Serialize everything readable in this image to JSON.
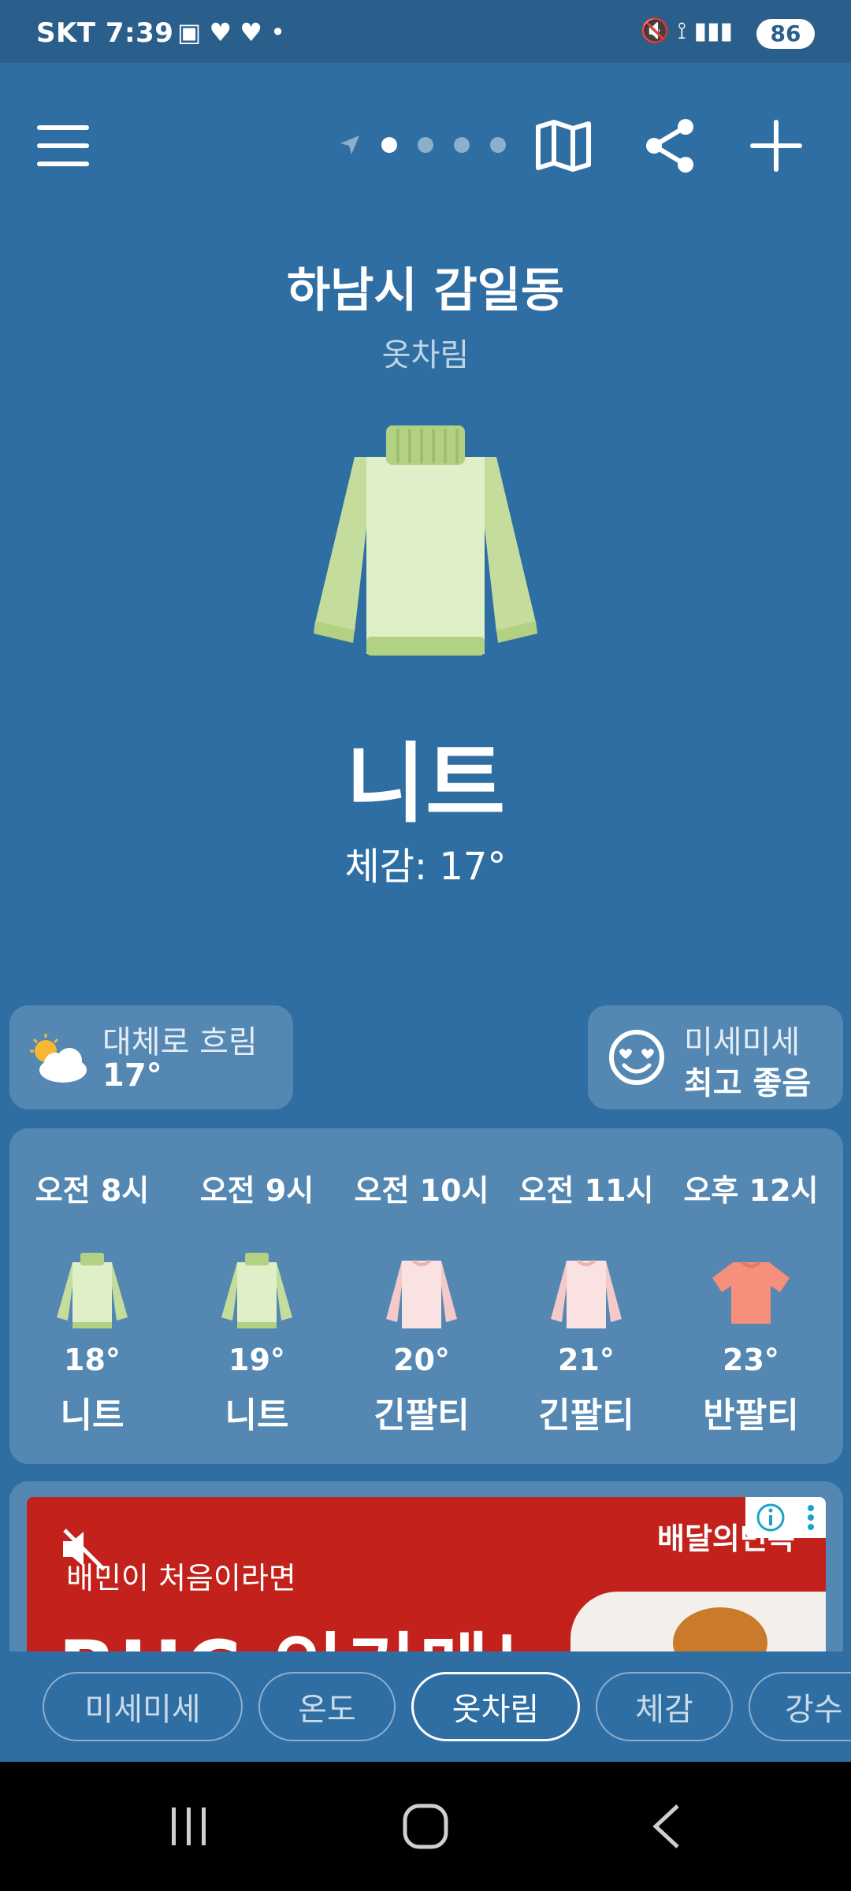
{
  "status_bar": {
    "carrier": "SKT",
    "time": "7:39",
    "battery": "86"
  },
  "header": {
    "location": "하남시 감일동",
    "subtitle": "옷차림"
  },
  "main": {
    "clothing": "니트",
    "feels_like": "체감: 17°"
  },
  "weather_card": {
    "condition": "대체로 흐림",
    "temp": "17°"
  },
  "dust_card": {
    "title": "미세미세",
    "status": "최고 좋음"
  },
  "hourly": [
    {
      "time": "오전 8시",
      "temp": "18°",
      "clothing": "니트",
      "icon": "sweater-icon"
    },
    {
      "time": "오전 9시",
      "temp": "19°",
      "clothing": "니트",
      "icon": "sweater-icon"
    },
    {
      "time": "오전 10시",
      "temp": "20°",
      "clothing": "긴팔티",
      "icon": "long-sleeve-icon"
    },
    {
      "time": "오전 11시",
      "temp": "21°",
      "clothing": "긴팔티",
      "icon": "long-sleeve-icon"
    },
    {
      "time": "오후 12시",
      "temp": "23°",
      "clothing": "반팔티",
      "icon": "tshirt-icon"
    }
  ],
  "ad": {
    "brand": "배달의민족",
    "subtext": "배민이 처음이라면",
    "headline": "BHC 인기메뉴"
  },
  "tabs": [
    {
      "label": "미세미세",
      "active": false
    },
    {
      "label": "온도",
      "active": false
    },
    {
      "label": "옷차림",
      "active": true
    },
    {
      "label": "체감",
      "active": false
    },
    {
      "label": "강수",
      "active": false
    }
  ],
  "colors": {
    "background": "#2f6ea3",
    "sweater": "#c4dd9c",
    "long_sleeve": "#f7d8d8",
    "tshirt": "#f6907d"
  }
}
